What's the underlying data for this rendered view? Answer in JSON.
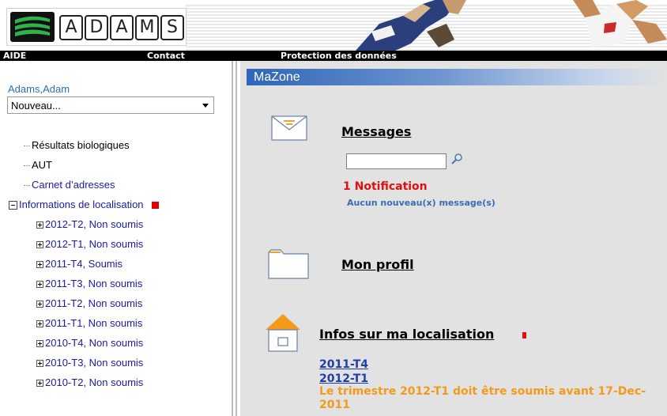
{
  "header": {
    "logo_letters": [
      "A",
      "D",
      "A",
      "M",
      "S"
    ]
  },
  "nav": {
    "help": "AIDE",
    "contact": "Contact",
    "privacy": "Protection des données"
  },
  "sidebar": {
    "user_name": "Adams,Adam",
    "select_value": "Nouveau...",
    "items": {
      "bio_results": "Résultats biologiques",
      "aut": "AUT",
      "address_book": "Carnet d’adresses",
      "location_info": "Informations de localisation"
    },
    "quarters": [
      "2012-T2, Non soumis",
      "2012-T1, Non soumis",
      "2011-T4, Soumis",
      "2011-T3, Non soumis",
      "2011-T2, Non soumis",
      "2011-T1, Non soumis",
      "2010-T4, Non soumis",
      "2010-T3, Non soumis",
      "2010-T2, Non soumis"
    ]
  },
  "main": {
    "zone_title": "MaZone",
    "messages_title": "Messages",
    "search_value": "",
    "notification": "1 Notification",
    "no_messages": "Aucun nouveau(x) message(s)",
    "profile_title": "Mon profil",
    "location_title": "Infos sur ma localisation",
    "location_links": [
      "2011-T4",
      "2012-T1"
    ],
    "deadline_text": "Le trimestre 2012-T1 doit être soumis avant 17-Dec-2011"
  },
  "colors": {
    "zone_bar": "#2f66b7",
    "notification": "#e01010",
    "deadline": "#f39a1a",
    "tree_link": "#1a1aa8"
  }
}
